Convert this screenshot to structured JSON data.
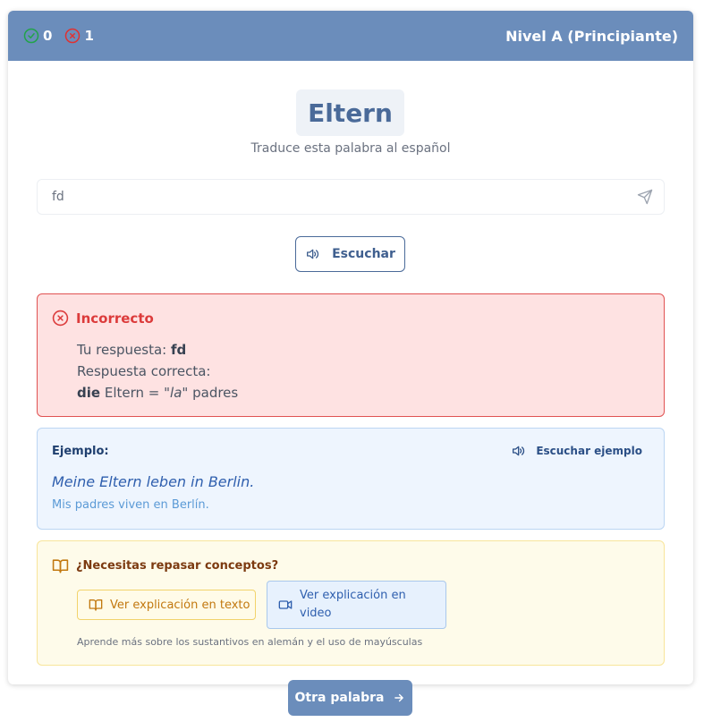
{
  "header": {
    "correct_count": "0",
    "incorrect_count": "1",
    "level": "Nivel A (Principiante)"
  },
  "word": {
    "text": "Eltern",
    "instruction": "Traduce esta palabra al español"
  },
  "answer_input": {
    "value": "fd"
  },
  "listen_button": {
    "label": "Escuchar"
  },
  "feedback": {
    "title": "Incorrecto",
    "your_answer_label": "Tu respuesta:",
    "your_answer": "fd",
    "correct_answer_label": "Respuesta correcta:",
    "article": "die",
    "word": "Eltern",
    "equals": "=",
    "translation_article": "\"la\"",
    "translation": "padres"
  },
  "example": {
    "label": "Ejemplo:",
    "listen_label": "Escuchar ejemplo",
    "sentence": "Meine Eltern leben in Berlin.",
    "translation": "Mis padres viven en Berlín."
  },
  "review": {
    "title": "¿Necesitas repasar conceptos?",
    "text_button": "Ver explicación en texto",
    "video_button": "Ver explicación en video",
    "note": "Aprende más sobre los sustantivos en alemán y el uso de mayúsculas"
  },
  "next_button": {
    "label": "Otra palabra"
  },
  "colors": {
    "header_bg": "#6b8dbb",
    "correct_green": "#22a34a",
    "incorrect_red": "#e03131",
    "error_bg": "#fee2e2",
    "example_bg": "#eef5fe",
    "review_bg": "#fefbea"
  },
  "icons": [
    "check-circle-icon",
    "x-circle-icon",
    "send-icon",
    "speaker-icon",
    "book-open-icon",
    "video-icon",
    "arrow-right-icon"
  ]
}
